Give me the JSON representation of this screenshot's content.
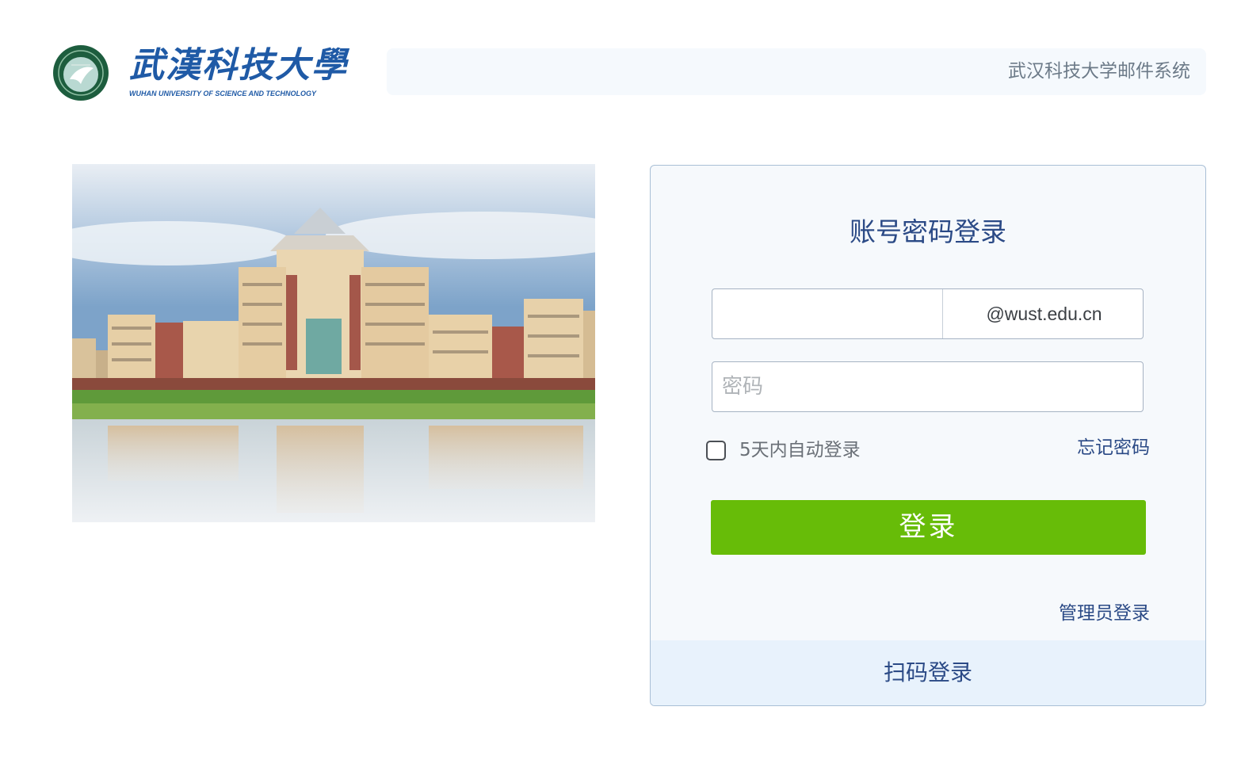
{
  "header": {
    "logo_cn": "武漢科技大學",
    "logo_en": "WUHAN UNIVERSITY OF SCIENCE AND TECHNOLOGY",
    "system_title": "武汉科技大学邮件系统"
  },
  "campus_image": {
    "icon": "campus-building-photo"
  },
  "login": {
    "title": "账号密码登录",
    "username_value": "",
    "domain_suffix": "@wust.edu.cn",
    "password_placeholder": "密码",
    "remember_label": "5天内自动登录",
    "remember_checked": false,
    "forgot_password": "忘记密码",
    "submit_label": "登录",
    "admin_login": "管理员登录",
    "qr_login": "扫码登录"
  },
  "colors": {
    "accent_blue": "#2b4a86",
    "button_green": "#67bc08",
    "panel_bg": "#f6f9fc",
    "qr_bar_bg": "#e8f2fc"
  }
}
